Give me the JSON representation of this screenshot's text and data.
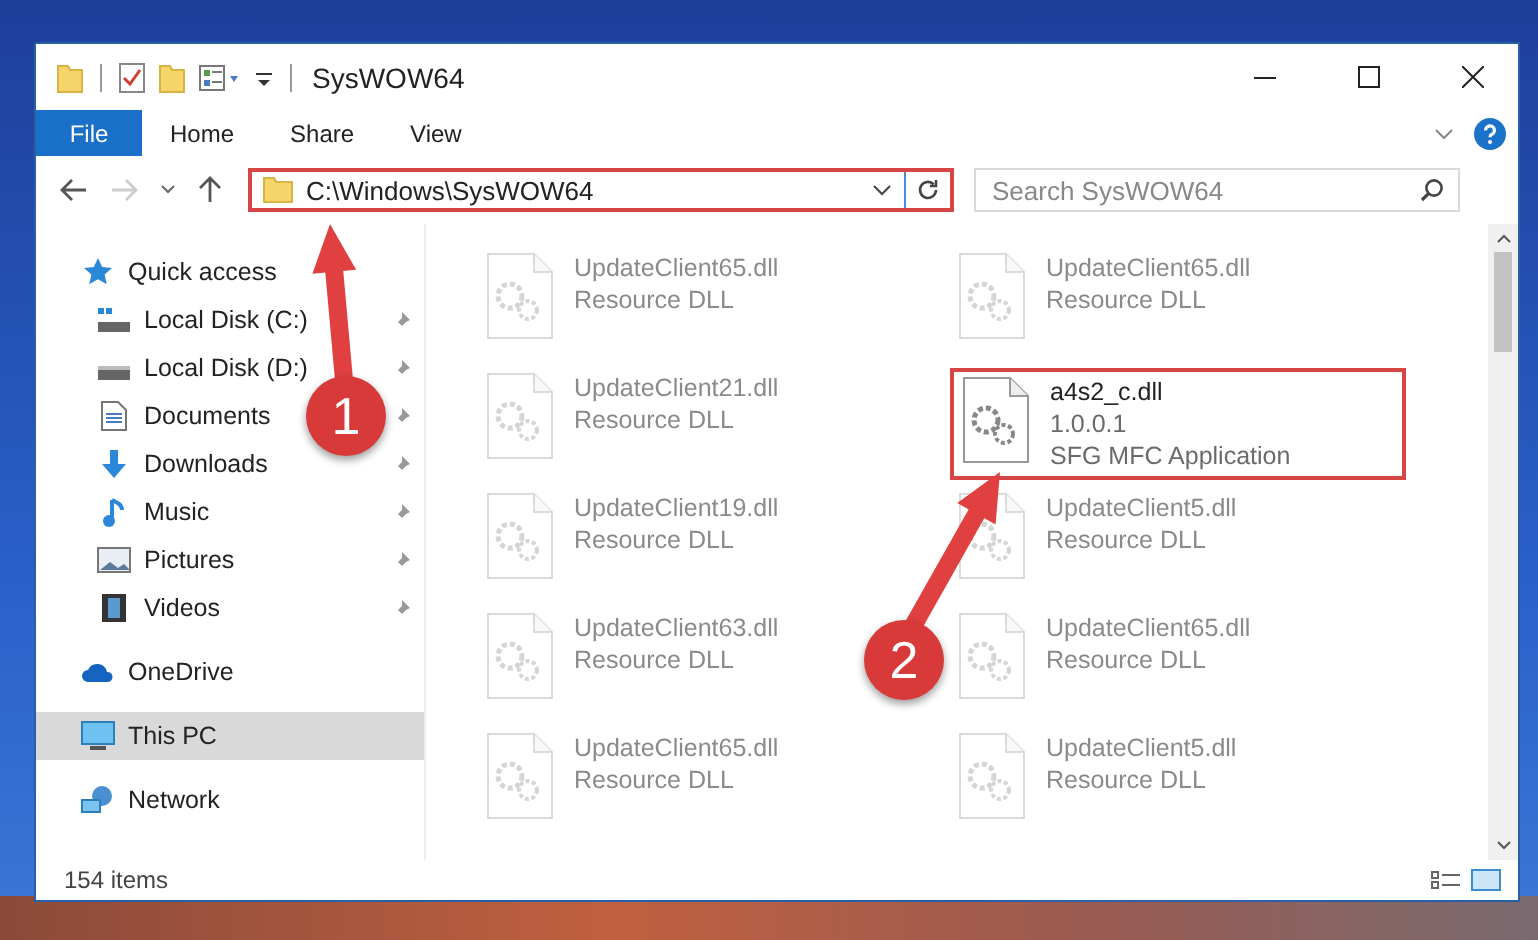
{
  "window": {
    "title": "SysWOW64"
  },
  "ribbon_tabs": [
    {
      "label": "File",
      "selected": true
    },
    {
      "label": "Home",
      "selected": false
    },
    {
      "label": "Share",
      "selected": false
    },
    {
      "label": "View",
      "selected": false
    }
  ],
  "address_bar": {
    "path": "C:\\Windows\\SysWOW64",
    "highlighted": true
  },
  "search": {
    "placeholder": "Search SysWOW64"
  },
  "sidebar": {
    "items": [
      {
        "label": "Quick access",
        "kind": "star",
        "selected": false,
        "children": [
          {
            "label": "Local Disk (C:)",
            "kind": "system-drive",
            "pinned": true,
            "selected": false
          },
          {
            "label": "Local Disk (D:)",
            "kind": "drive",
            "pinned": true,
            "selected": false
          },
          {
            "label": "Documents",
            "kind": "document",
            "pinned": true,
            "selected": false
          },
          {
            "label": "Downloads",
            "kind": "download",
            "pinned": true,
            "selected": false
          },
          {
            "label": "Music",
            "kind": "music",
            "pinned": true,
            "selected": false
          },
          {
            "label": "Pictures",
            "kind": "picture",
            "pinned": true,
            "selected": false
          },
          {
            "label": "Videos",
            "kind": "video",
            "pinned": true,
            "selected": false
          }
        ]
      },
      {
        "label": "OneDrive",
        "kind": "cloud",
        "selected": false
      },
      {
        "label": "This PC",
        "kind": "computer",
        "selected": true
      },
      {
        "label": "Network",
        "kind": "network",
        "selected": false
      }
    ]
  },
  "files": [
    {
      "name": "UpdateClient65.dll",
      "details": [
        "Resource DLL"
      ],
      "faded": true,
      "highlighted": false
    },
    {
      "name": "UpdateClient65.dll",
      "details": [
        "Resource DLL"
      ],
      "faded": true,
      "highlighted": false
    },
    {
      "name": "UpdateClient21.dll",
      "details": [
        "Resource DLL"
      ],
      "faded": true,
      "highlighted": false
    },
    {
      "name": "a4s2_c.dll",
      "details": [
        "1.0.0.1",
        "SFG MFC Application"
      ],
      "faded": false,
      "highlighted": true
    },
    {
      "name": "UpdateClient19.dll",
      "details": [
        "Resource DLL"
      ],
      "faded": true,
      "highlighted": false
    },
    {
      "name": "UpdateClient5.dll",
      "details": [
        "Resource DLL"
      ],
      "faded": true,
      "highlighted": false
    },
    {
      "name": "UpdateClient63.dll",
      "details": [
        "Resource DLL"
      ],
      "faded": true,
      "highlighted": false
    },
    {
      "name": "UpdateClient65.dll",
      "details": [
        "Resource DLL"
      ],
      "faded": true,
      "highlighted": false
    },
    {
      "name": "UpdateClient65.dll",
      "details": [
        "Resource DLL"
      ],
      "faded": true,
      "highlighted": false
    },
    {
      "name": "UpdateClient5.dll",
      "details": [
        "Resource DLL"
      ],
      "faded": true,
      "highlighted": false
    }
  ],
  "status_bar": {
    "item_count": "154 items"
  },
  "annotations": [
    {
      "label": "1"
    },
    {
      "label": "2"
    }
  ]
}
